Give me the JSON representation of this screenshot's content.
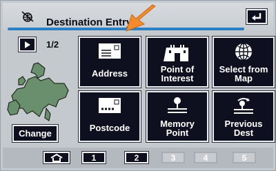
{
  "header": {
    "title": "Destination Entry"
  },
  "pager": {
    "indicator": "1/2"
  },
  "left": {
    "change_label": "Change"
  },
  "tiles": [
    {
      "label": "Address",
      "icon": "address-icon"
    },
    {
      "label": "Point of\nInterest",
      "icon": "castle-icon"
    },
    {
      "label": "Select from\nMap",
      "icon": "globe-icon"
    },
    {
      "label": "Postcode",
      "icon": "postcode-icon"
    },
    {
      "label": "Memory\nPoint",
      "icon": "memory-point-icon"
    },
    {
      "label": "Previous\nDest",
      "icon": "previous-dest-icon"
    }
  ],
  "bottom": {
    "home_icon": "home-icon",
    "pages": [
      {
        "label": "1",
        "state": "active"
      },
      {
        "label": "2",
        "state": "active"
      },
      {
        "label": "3",
        "state": "disabled"
      },
      {
        "label": "4",
        "state": "disabled"
      },
      {
        "label": "5",
        "state": "disabled"
      }
    ]
  },
  "colors": {
    "accent_line": "#2a80c6",
    "highlight_arrow": "#f38b2a",
    "tile_bg": "#0e1020"
  }
}
